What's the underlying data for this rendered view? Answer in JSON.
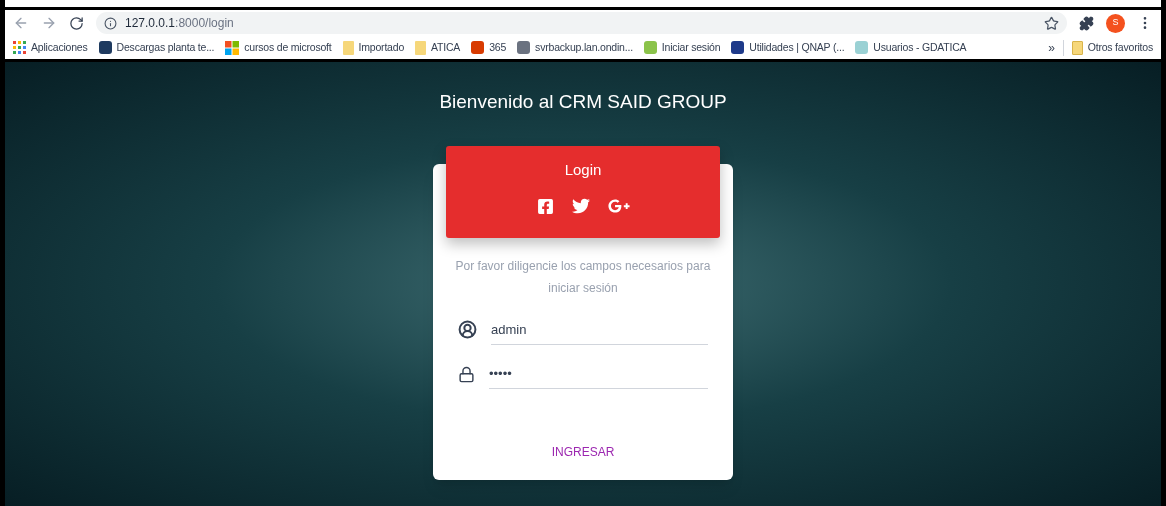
{
  "browser": {
    "url_host": "127.0.0.1",
    "url_path": ":8000/login",
    "profile_initial": "S"
  },
  "bookmarks": [
    {
      "label": "Aplicaciones",
      "kind": "apps"
    },
    {
      "label": "Descargas planta te...",
      "kind": "site",
      "color": "#1e3a5f"
    },
    {
      "label": "cursos de microsoft",
      "kind": "windows"
    },
    {
      "label": "Importado",
      "kind": "folder",
      "color": "#f6d77a"
    },
    {
      "label": "ATICA",
      "kind": "folder",
      "color": "#f6d77a"
    },
    {
      "label": "365",
      "kind": "site",
      "color": "#d83b01"
    },
    {
      "label": "svrbackup.lan.ondin...",
      "kind": "site",
      "color": "#6b7280"
    },
    {
      "label": "Iniciar sesión",
      "kind": "site",
      "color": "#8bc34a"
    },
    {
      "label": "Utilidades | QNAP (...",
      "kind": "site",
      "color": "#1e3a8a"
    },
    {
      "label": "Usuarios - GDATICA",
      "kind": "site",
      "color": "#9ad1d4"
    }
  ],
  "overflow": "»",
  "other_bookmarks": {
    "label": "Otros favoritos"
  },
  "page": {
    "heading": "Bienvenido al CRM SAID GROUP"
  },
  "login_card": {
    "title": "Login",
    "social": [
      {
        "kind": "facebook"
      },
      {
        "kind": "twitter"
      },
      {
        "kind": "google-plus"
      }
    ],
    "description": "Por favor diligencie los campos necesarios para iniciar sesión",
    "fields": [
      {
        "kind": "user",
        "value": "admin"
      },
      {
        "kind": "password",
        "value": "•••••"
      }
    ],
    "submit": "INGRESAR"
  }
}
